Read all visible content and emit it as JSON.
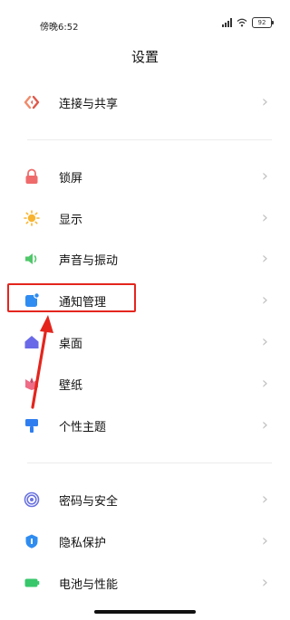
{
  "status_bar": {
    "time": "傍晚6:52",
    "battery": "92"
  },
  "page": {
    "title": "设置"
  },
  "sections": [
    {
      "items": [
        {
          "label": "连接与共享",
          "icon": "connection-share-icon"
        }
      ]
    },
    {
      "items": [
        {
          "label": "锁屏",
          "icon": "lock-icon"
        },
        {
          "label": "显示",
          "icon": "sun-icon"
        },
        {
          "label": "声音与振动",
          "icon": "speaker-icon"
        },
        {
          "label": "通知管理",
          "icon": "notification-icon"
        },
        {
          "label": "桌面",
          "icon": "home-icon"
        },
        {
          "label": "壁纸",
          "icon": "wallpaper-flower-icon"
        },
        {
          "label": "个性主题",
          "icon": "brush-icon"
        }
      ]
    },
    {
      "items": [
        {
          "label": "密码与安全",
          "icon": "fingerprint-icon"
        },
        {
          "label": "隐私保护",
          "icon": "shield-icon"
        },
        {
          "label": "电池与性能",
          "icon": "battery-icon"
        }
      ]
    }
  ],
  "colors": {
    "highlight_border": "#e4251d",
    "arrow": "#e4251d",
    "chevron": "#c2c2c2"
  }
}
